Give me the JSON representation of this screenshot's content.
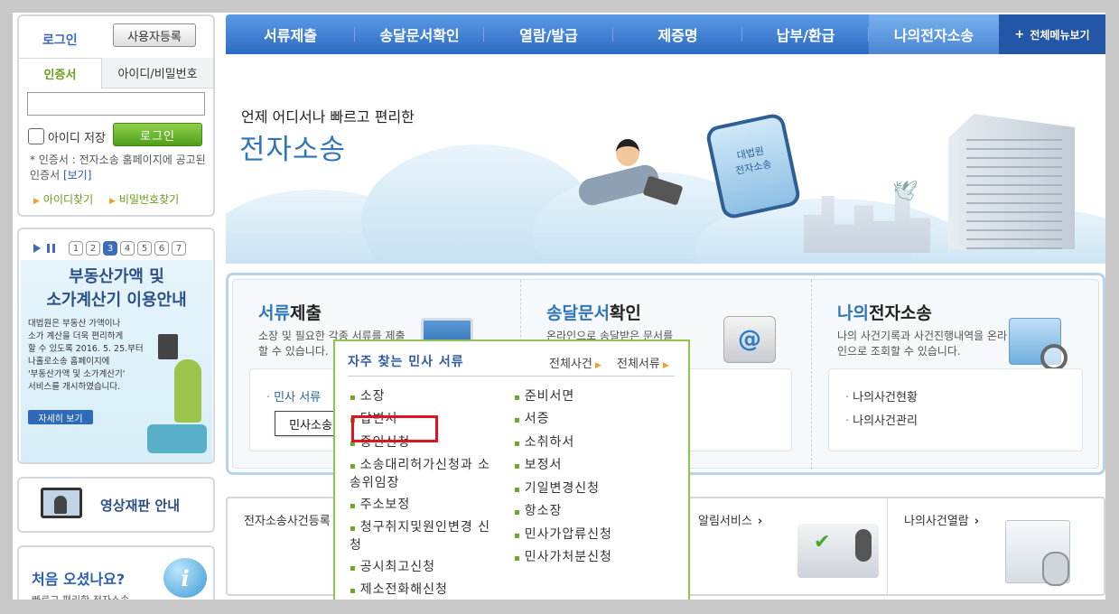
{
  "login": {
    "title": "로그인",
    "register_label": "사용자등록",
    "tab_cert": "인증서",
    "tab_id": "아이디/비밀번호",
    "remember_label": "아이디 저장",
    "login_button": "로그인",
    "cert_note": "* 인증서 : 전자소송 홈페이지에 공고된 인증서",
    "cert_view": "[보기]",
    "find_id": "아이디찾기",
    "find_pw": "비밀번호찾기"
  },
  "banner": {
    "pages": [
      "1",
      "2",
      "3",
      "4",
      "5",
      "6",
      "7"
    ],
    "active_page": "3",
    "title_line1": "부동산가액 및",
    "title_line2": "소가계산기 이용안내",
    "text_lines": [
      "대법원은 부동산 가액이나",
      "소가 계산을 더욱 편리하게",
      "할 수 있도록 2016. 5. 25.부터",
      "나홀로소송 홈페이지에",
      "'부동산가액 및 소가계산기'",
      "서비스를 개시하였습니다."
    ],
    "more": "자세히 보기"
  },
  "video": {
    "label": "영상재판 안내"
  },
  "first_visit": {
    "title": "처음 오셨나요?",
    "subtitle": "빠르고 편리한 전자소송"
  },
  "nav": {
    "items": [
      "서류제출",
      "송달문서확인",
      "열람/발급",
      "제증명",
      "납부/환급",
      "나의전자소송"
    ],
    "all_menu": "전체메뉴보기"
  },
  "hero": {
    "subtitle": "언제 어디서나 빠르고 편리한",
    "title": "전자소송",
    "tablet_text_1": "대법원",
    "tablet_text_2": "전자소송"
  },
  "services": [
    {
      "title_hl": "서류",
      "title_rest": "제출",
      "desc": "소장 및 필요한 각종 서류를 제출할 수 있습니다.",
      "links": [
        "민사 서류"
      ]
    },
    {
      "title_hl": "송달문서",
      "title_rest": "확인",
      "desc": "온라인으로 송달받은 문서를"
    },
    {
      "title_hl": "나의",
      "title_rest": "전자소송",
      "desc": "나의 사건기록과 사건진행내역을 온라인으로 조회할 수 있습니다.",
      "links": [
        "나의사건현황",
        "나의사건관리"
      ]
    }
  ],
  "tooltip": "민사소송",
  "quick": [
    {
      "label": "전자소송사건등록"
    },
    {
      "label": "알림서비스"
    },
    {
      "label": "나의사건열람"
    }
  ],
  "popup": {
    "title": "자주 찾는 민사 서류",
    "all_cases": "전체사건",
    "all_docs": "전체서류",
    "left_items": [
      "소장",
      "답변서",
      "증인신청",
      "소송대리허가신청과 소송위임장",
      "주소보정",
      "청구취지및원인변경 신청",
      "공시최고신청",
      "제소전화해신청"
    ],
    "right_items": [
      "준비서면",
      "서증",
      "소취하서",
      "보정서",
      "기일변경신청",
      "항소장",
      "민사가압류신청",
      "민사가처분신청"
    ]
  }
}
